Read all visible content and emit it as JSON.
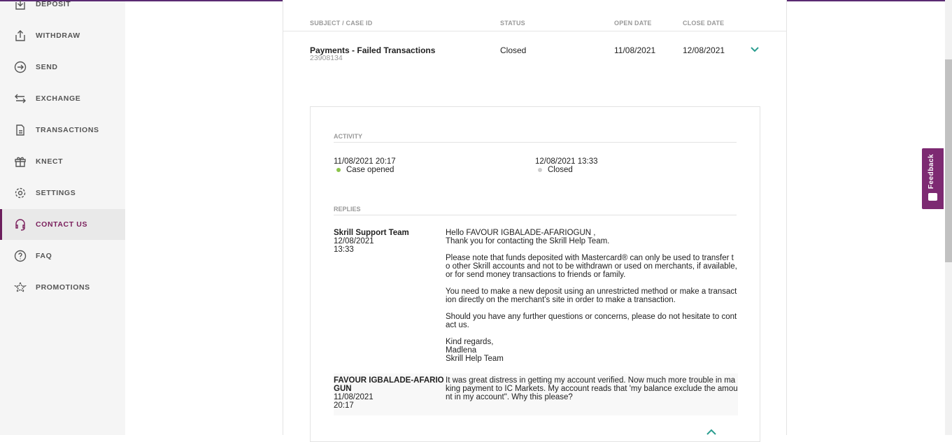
{
  "sidebar": {
    "items": [
      {
        "label": "DEPOSIT",
        "icon": "deposit-icon"
      },
      {
        "label": "WITHDRAW",
        "icon": "withdraw-icon"
      },
      {
        "label": "SEND",
        "icon": "send-icon"
      },
      {
        "label": "EXCHANGE",
        "icon": "exchange-icon"
      },
      {
        "label": "TRANSACTIONS",
        "icon": "document-icon"
      },
      {
        "label": "KNECT",
        "icon": "gift-icon"
      },
      {
        "label": "SETTINGS",
        "icon": "gear-icon"
      },
      {
        "label": "CONTACT US",
        "icon": "headset-icon",
        "active": true
      },
      {
        "label": "FAQ",
        "icon": "question-icon"
      },
      {
        "label": "PROMOTIONS",
        "icon": "star-icon"
      }
    ]
  },
  "table": {
    "headers": [
      "SUBJECT / CASE ID",
      "STATUS",
      "OPEN DATE",
      "CLOSE DATE"
    ],
    "row": {
      "subject": "Payments - Failed Transactions",
      "case_id": "23908134",
      "status": "Closed",
      "open_date": "11/08/2021",
      "close_date": "12/08/2021"
    }
  },
  "activity": {
    "label": "ACTIVITY",
    "events": [
      {
        "datetime": "11/08/2021 20:17",
        "text": "Case opened",
        "color": "#8bc34a"
      },
      {
        "datetime": "12/08/2021 13:33",
        "text": "Closed",
        "color": "#cccccc"
      }
    ]
  },
  "replies": {
    "label": "REPLIES",
    "items": [
      {
        "author": "Skrill Support Team",
        "date": "12/08/2021",
        "time": "13:33",
        "paragraphs": [
          "Hello FAVOUR IGBALADE-AFARIOGUN ,\nThank you for contacting the Skrill Help Team.",
          "Please note that funds deposited with Mastercard® can only be used to transfer to other Skrill accounts and not to be withdrawn or used on merchants, if available, or for send money transactions to friends or family.",
          "You need to make a new deposit using an unrestricted method or make a transaction directly on the merchant's site in order to make a transaction.",
          "Should you have any further questions or concerns, please do not hesitate to contact us.",
          "Kind regards,\nMadlena\nSkrill Help Team"
        ]
      },
      {
        "author": "FAVOUR IGBALADE-AFARIOGUN",
        "date": "11/08/2021",
        "time": "20:17",
        "paragraphs": [
          "It was great distress in getting my account verified. Now much more trouble in making payment to IC Markets. My account reads that 'my balance exclude the amount in my account\". Why this please?"
        ]
      }
    ]
  },
  "feedback": {
    "label": "Feedback"
  },
  "colors": {
    "accent": "#7d2a72",
    "teal": "#2a9d8f"
  }
}
